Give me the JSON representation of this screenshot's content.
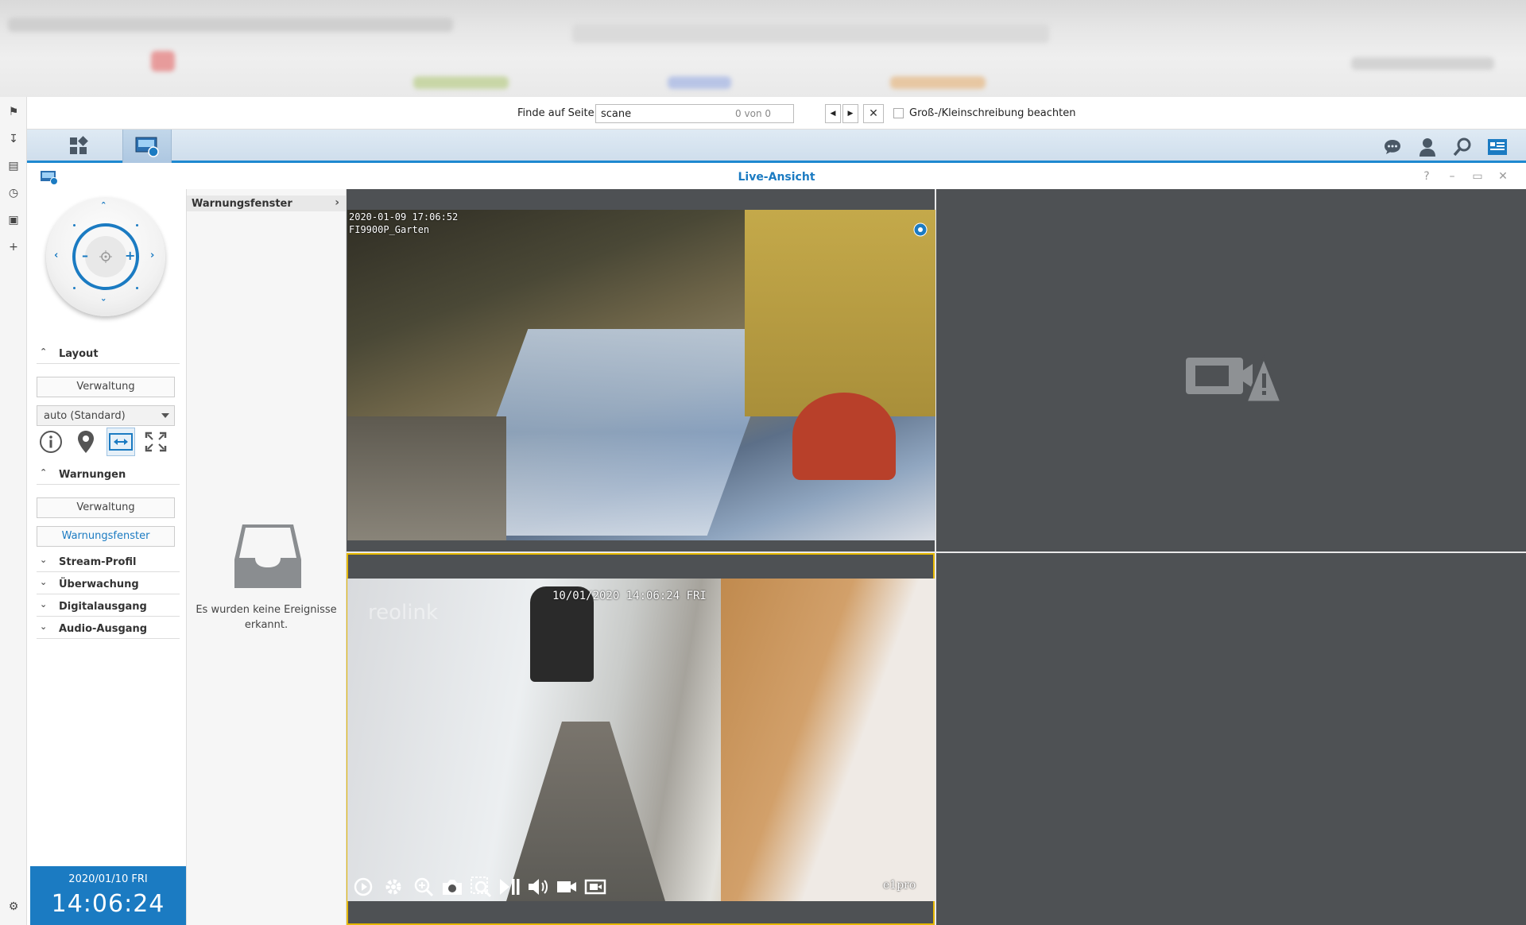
{
  "findbar": {
    "label": "Finde auf Seite:",
    "query": "scane",
    "count": "0 von 0",
    "case_label": "Groß-/Kleinschreibung beachten"
  },
  "window": {
    "title": "Live-Ansicht",
    "help": "?",
    "minimize": "–",
    "maximize": "▭",
    "close": "✕"
  },
  "left_panel": {
    "layout_section": "Layout",
    "layout_manage": "Verwaltung",
    "layout_select": "auto (Standard)",
    "warnings_section": "Warnungen",
    "warnings_manage": "Verwaltung",
    "warnings_window": "Warnungsfenster",
    "sections": [
      "Stream-Profil",
      "Überwachung",
      "Digitalausgang",
      "Audio-Ausgang"
    ],
    "date": "2020/01/10  FRI",
    "time": "14:06:24"
  },
  "warning_panel": {
    "title": "Warnungsfenster",
    "empty_line1": "Es wurden keine Ereignisse",
    "empty_line2": "erkannt."
  },
  "cameras": {
    "cam1_timestamp": "2020-01-09 17:06:52",
    "cam1_name": "FI9900P_Garten",
    "cam2_timestamp": "10/01/2020  14:06:24  FRI",
    "cam2_brand": "reolink",
    "cam2_model": "e1pro"
  },
  "colors": {
    "accent": "#1b7bc2",
    "selected_cell": "#e6b800",
    "empty_cell": "#4e5154"
  }
}
